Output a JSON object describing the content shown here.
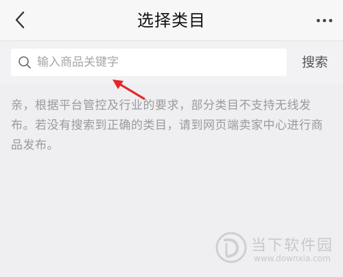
{
  "nav": {
    "title": "选择类目",
    "back_icon": "chevron-left-icon",
    "more_icon": "more-horizontal-icon"
  },
  "search": {
    "placeholder": "输入商品关键字",
    "value": "",
    "button_label": "搜索",
    "icon": "search-icon"
  },
  "notice": {
    "text": "亲，根据平台管控及行业的要求，部分类目不支持无线发布。若没有搜索到正确的类目，请到网页端卖家中心进行商品发布。"
  },
  "annotation": {
    "arrow_color": "#e5262a"
  },
  "watermark": {
    "name": "当下软件园",
    "url": "www.downxia.com"
  },
  "colors": {
    "background": "#efeff1",
    "nav_background": "#f7f7f7",
    "search_box": "#ffffff",
    "notice_text": "#9a9a9c"
  }
}
